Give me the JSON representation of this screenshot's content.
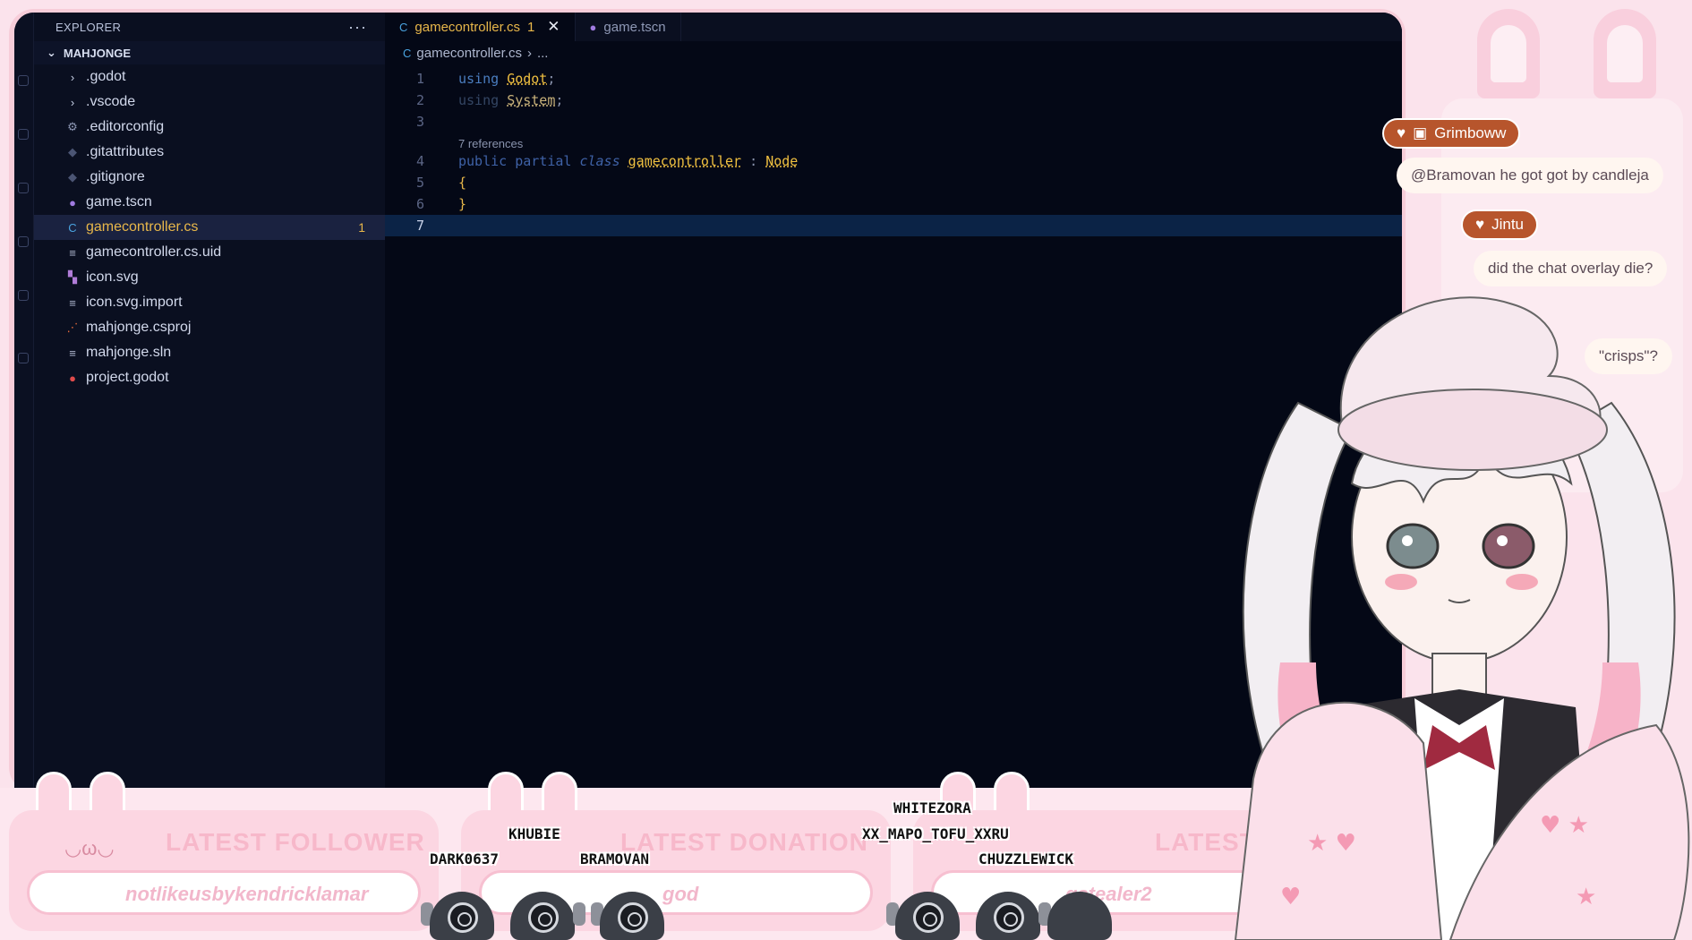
{
  "explorer": {
    "title": "EXPLORER",
    "more": "···",
    "folder": "MAHJONGE",
    "items": [
      {
        "label": ".godot",
        "icon": "chevron-right-icon",
        "glyph": "›"
      },
      {
        "label": ".vscode",
        "icon": "chevron-right-icon",
        "glyph": "›"
      },
      {
        "label": ".editorconfig",
        "icon": "gear-icon",
        "glyph": "⚙"
      },
      {
        "label": ".gitattributes",
        "icon": "git-icon",
        "glyph": "◆"
      },
      {
        "label": ".gitignore",
        "icon": "git-icon",
        "glyph": "◆"
      },
      {
        "label": "game.tscn",
        "icon": "godot-scene-icon",
        "glyph": "●"
      },
      {
        "label": "gamecontroller.cs",
        "icon": "csharp-icon",
        "glyph": "C",
        "badge": "1"
      },
      {
        "label": "gamecontroller.cs.uid",
        "icon": "text-file-icon",
        "glyph": "≡"
      },
      {
        "label": "icon.svg",
        "icon": "image-icon",
        "glyph": "▚"
      },
      {
        "label": "icon.svg.import",
        "icon": "text-file-icon",
        "glyph": "≡"
      },
      {
        "label": "mahjonge.csproj",
        "icon": "rss-icon",
        "glyph": "⋰"
      },
      {
        "label": "mahjonge.sln",
        "icon": "text-file-icon",
        "glyph": "≡"
      },
      {
        "label": "project.godot",
        "icon": "godot-icon",
        "glyph": "●"
      }
    ]
  },
  "tabs": [
    {
      "label": "gamecontroller.cs",
      "badge": "1",
      "close": "✕"
    },
    {
      "label": "game.tscn"
    }
  ],
  "breadcrumb": {
    "file": "gamecontroller.cs",
    "sep": "›",
    "rest": "..."
  },
  "code": {
    "line_numbers": [
      "1",
      "2",
      "3",
      "4",
      "5",
      "6",
      "7"
    ],
    "references": "7 references",
    "using": "using",
    "godot": "Godot",
    "system": "System",
    "semicolon": ";",
    "public": "public",
    "partial": "partial",
    "class_kw": "class",
    "class_name": "gamecontroller",
    "colon": ":",
    "base": "Node",
    "open_brace": "{",
    "close_brace": "}"
  },
  "chat": {
    "messages": [
      {
        "user": "Grimboww",
        "text": "@Bramovan he got got by candleja"
      },
      {
        "user": "Jintu",
        "text": "did the chat overlay die?"
      },
      {
        "user": "",
        "text": "\"crisps\"?"
      }
    ]
  },
  "widgets": {
    "follower": {
      "title": "LATEST FOLLOWER",
      "value": "notlikeusbykendricklamar"
    },
    "donation": {
      "title": "LATEST DONATION",
      "value": "god"
    },
    "sub": {
      "title": "LATEST SU",
      "value": "gstealer2"
    }
  },
  "viewers": [
    "WHITEZORA",
    "XX_MAPO_TOFU_XXRU",
    "KHUBIE",
    "DARK0637",
    "BRAMOVAN",
    "CHUZZLEWICK"
  ],
  "colors": {
    "accent": "#e8b74a",
    "editor_bg": "#040816",
    "pink": "#fbe3ec"
  }
}
